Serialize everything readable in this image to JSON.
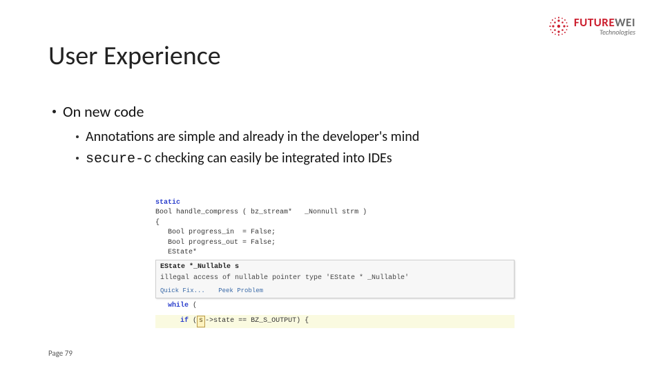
{
  "logo": {
    "main_red": "FUTURE",
    "main_gray": "WEI",
    "sub": "Technologies"
  },
  "title": "User Experience",
  "bullets": {
    "l1": "On new code",
    "l2a": "Annotations are simple and already in the developer's mind",
    "l2b_code": "secure-c",
    "l2b_rest": " checking can easily be integrated into IDEs"
  },
  "code": {
    "kw_static": "static",
    "line2_a": "Bool handle_compress ( bz_stream*   ",
    "line2_b": "_Nonnull",
    "line2_c": " strm )",
    "line3": "{",
    "line4": "   Bool progress_in  = False;",
    "line5": "   Bool progress_out = False;",
    "line6": "   EState*",
    "popup_type_prefix": "   ",
    "popup_type_bold": "EState *_Nullable s",
    "popup_msg": "illegal access of nullable pointer type 'EState * _Nullable'",
    "action_quickfix": "Quick Fix...",
    "action_peek": "Peek Problem",
    "kw_while": "while",
    "line_while_rest": " (",
    "kw_if": "if",
    "if_prefix": "      ",
    "if_open": " (",
    "sel_text": "s",
    "if_rest": "->state == BZ_S_OUTPUT) {"
  },
  "page": "Page 79"
}
